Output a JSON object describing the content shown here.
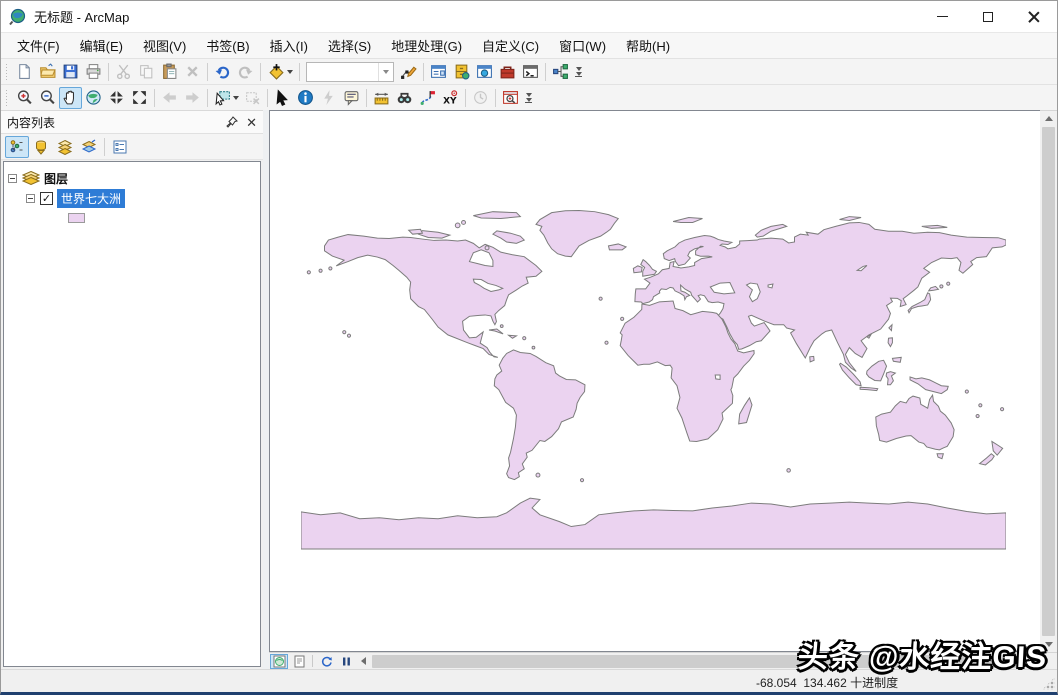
{
  "window": {
    "title": "无标题 - ArcMap"
  },
  "menu": {
    "items": [
      "文件(F)",
      "编辑(E)",
      "视图(V)",
      "书签(B)",
      "插入(I)",
      "选择(S)",
      "地理处理(G)",
      "自定义(C)",
      "窗口(W)",
      "帮助(H)"
    ]
  },
  "toolbars": {
    "standard_icons": [
      "new-document",
      "open",
      "save",
      "print",
      "cut",
      "copy",
      "paste",
      "delete",
      "undo",
      "redo",
      "add-data",
      "map-scale-combo",
      "editor-sketch",
      "table-of-contents-window",
      "catalog-window",
      "search-window",
      "arctoolbox-window",
      "python-window",
      "modelbuilder",
      "toolbar-overflow"
    ],
    "tools_icons": [
      "zoom-in",
      "zoom-out",
      "pan",
      "full-extent",
      "fixed-zoom-in",
      "fixed-zoom-out",
      "back-extent",
      "forward-extent",
      "select-features",
      "clear-selection",
      "select-elements",
      "identify",
      "hyperlink",
      "html-popup",
      "measure",
      "find",
      "find-route",
      "go-to-xy",
      "time-slider",
      "viewer-window",
      "toolbar-overflow"
    ],
    "scale_value": ""
  },
  "toc": {
    "title": "内容列表",
    "buttons": [
      "list-by-drawing-order",
      "list-by-source",
      "list-by-visibility",
      "list-by-selection",
      "options"
    ],
    "root_label": "图层",
    "layer": {
      "name": "世界七大洲",
      "checked": true,
      "swatch_color": "#EBD3F0"
    }
  },
  "map": {
    "view_buttons": [
      "data-view",
      "layout-view",
      "refresh",
      "pause"
    ],
    "land_fill": "#EBD3F0",
    "land_stroke": "#7C7C7C"
  },
  "statusbar": {
    "coordinates": "-68.054  134.462 十进制度"
  },
  "watermark": {
    "text": "头条 @水经注GIS"
  },
  "icons": {
    "check": "✓",
    "close": "✕"
  },
  "colors": {
    "selection_highlight": "#2E7CD6",
    "pressed_button": "#CDE6F7",
    "pressed_border": "#66A7DA"
  }
}
